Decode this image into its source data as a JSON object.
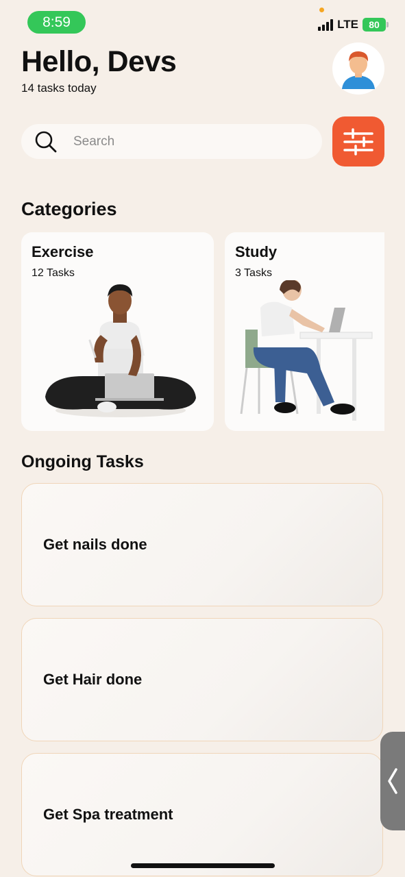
{
  "status": {
    "time": "8:59",
    "network": "LTE",
    "battery": "80"
  },
  "header": {
    "greeting": "Hello, Devs",
    "subtitle": "14 tasks today"
  },
  "search": {
    "placeholder": "Search"
  },
  "categories": {
    "title": "Categories",
    "items": [
      {
        "name": "Exercise",
        "count": "12 Tasks"
      },
      {
        "name": "Study",
        "count": "3 Tasks"
      }
    ]
  },
  "ongoing": {
    "title": "Ongoing Tasks",
    "items": [
      {
        "title": "Get nails done"
      },
      {
        "title": "Get Hair done"
      },
      {
        "title": "Get Spa treatment"
      }
    ]
  },
  "colors": {
    "accent": "#f05a32",
    "status_green": "#34c759",
    "background": "#f6efe8",
    "card_border": "#f0d5b8"
  },
  "icons": [
    "search-icon",
    "filter-sliders-icon",
    "avatar-icon",
    "chevron-left-icon"
  ]
}
